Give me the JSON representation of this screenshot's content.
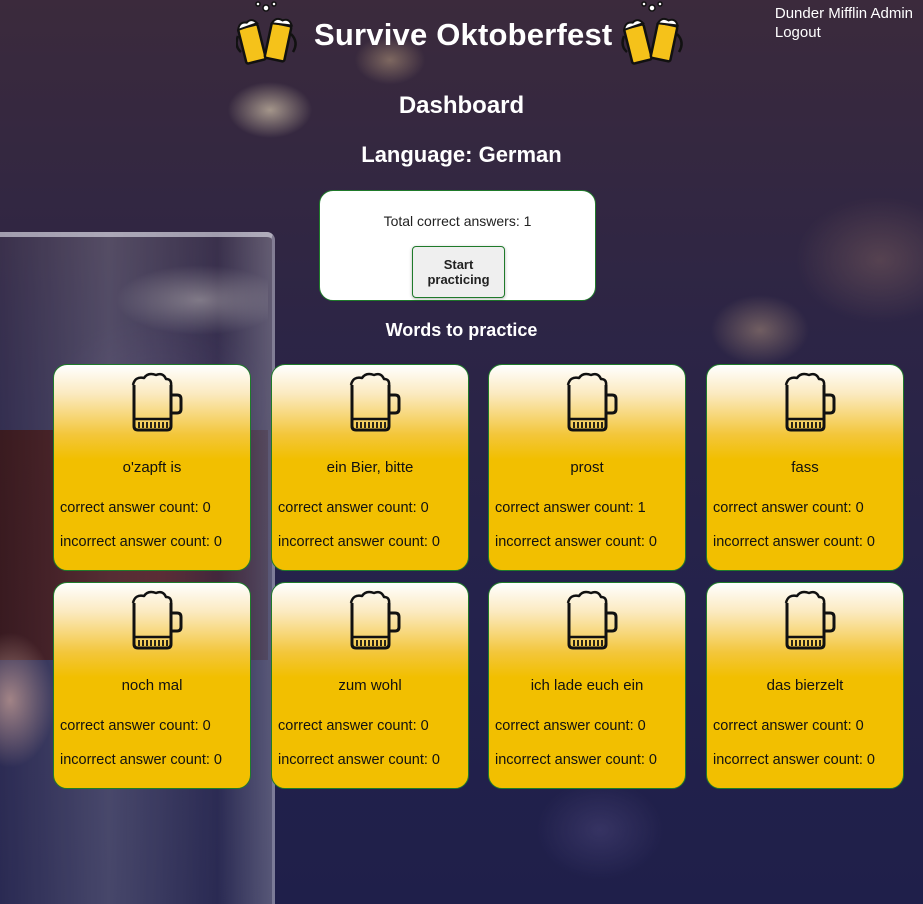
{
  "header": {
    "title": "Survive Oktoberfest",
    "left_icon": "beer-cheers-icon",
    "right_icon": "beer-cheers-icon",
    "user_name": "Dunder Mifflin Admin",
    "logout_label": "Logout"
  },
  "main": {
    "heading": "Dashboard",
    "language": "Language: German",
    "total_correct": "Total correct answers: 1",
    "start_label": "Start practicing",
    "words_heading": "Words to practice"
  },
  "words": [
    {
      "word": "o'zapft is",
      "correct": "correct answer count: 0",
      "incorrect": "incorrect answer count: 0"
    },
    {
      "word": "ein Bier, bitte",
      "correct": "correct answer count: 0",
      "incorrect": "incorrect answer count: 0"
    },
    {
      "word": "prost",
      "correct": "correct answer count: 1",
      "incorrect": "incorrect answer count: 0"
    },
    {
      "word": "fass",
      "correct": "correct answer count: 0",
      "incorrect": "incorrect answer count: 0"
    },
    {
      "word": "noch mal",
      "correct": "correct answer count: 0",
      "incorrect": "incorrect answer count: 0"
    },
    {
      "word": "zum wohl",
      "correct": "correct answer count: 0",
      "incorrect": "incorrect answer count: 0"
    },
    {
      "word": "ich lade euch ein",
      "correct": "correct answer count: 0",
      "incorrect": "incorrect answer count: 0"
    },
    {
      "word": "das bierzelt",
      "correct": "correct answer count: 0",
      "incorrect": "incorrect answer count: 0"
    }
  ],
  "colors": {
    "card_gold": "#f2bf00",
    "border_green": "#1f7a2a"
  },
  "card_icon": "beer-mug-icon"
}
